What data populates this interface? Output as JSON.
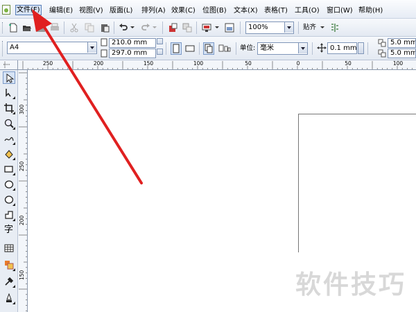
{
  "menu": {
    "items": [
      {
        "label": "文件(F)",
        "name": "menu-file",
        "active": true
      },
      {
        "label": "编辑(E)",
        "name": "menu-edit"
      },
      {
        "label": "视图(V)",
        "name": "menu-view"
      },
      {
        "label": "版面(L)",
        "name": "menu-layout"
      },
      {
        "label": "排列(A)",
        "name": "menu-arrange"
      },
      {
        "label": "效果(C)",
        "name": "menu-effects"
      },
      {
        "label": "位图(B)",
        "name": "menu-bitmaps"
      },
      {
        "label": "文本(X)",
        "name": "menu-text"
      },
      {
        "label": "表格(T)",
        "name": "menu-table"
      },
      {
        "label": "工具(O)",
        "name": "menu-tools"
      },
      {
        "label": "窗口(W)",
        "name": "menu-window"
      },
      {
        "label": "帮助(H)",
        "name": "menu-help"
      }
    ]
  },
  "standard_toolbar": {
    "zoom_value": "100%",
    "snap_label": "贴齐"
  },
  "property_bar": {
    "paper_size": "A4",
    "width": "210.0 mm",
    "height": "297.0 mm",
    "units_label": "单位:",
    "units_value": "毫米",
    "nudge_value": "0.1 mm",
    "duplicate_x": "5.0 mm",
    "duplicate_y": "5.0 mm"
  },
  "rulers": {
    "horizontal_labels": [
      "250",
      "200",
      "150",
      "100",
      "50",
      "0",
      "50",
      "100"
    ],
    "vertical_labels": [
      "300",
      "250",
      "200",
      "150"
    ]
  },
  "toolbox": {
    "tools": [
      "pick-tool-icon",
      "shape-tool-icon",
      "crop-tool-icon",
      "zoom-tool-icon",
      "freehand-tool-icon",
      "smart-fill-icon",
      "rectangle-tool-icon",
      "ellipse-tool-icon",
      "polygon-tool-icon",
      "basic-shapes-icon",
      "text-tool-icon",
      "table-tool-icon",
      "interactive-tool-icon",
      "eyedropper-tool-icon",
      "outline-tool-icon"
    ],
    "text_tool_glyph": "字"
  },
  "watermark": "软件技巧",
  "colors": {
    "annotation_arrow": "#e02020",
    "menu_active_bg": "#d6e3f5"
  }
}
